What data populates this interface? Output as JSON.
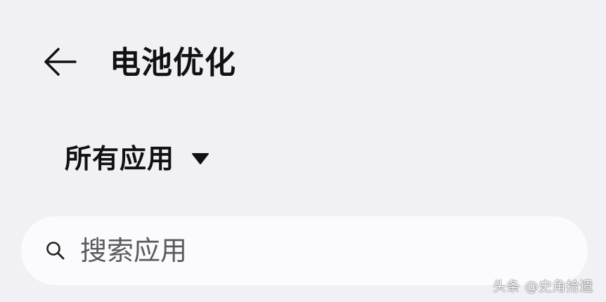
{
  "header": {
    "back_icon": "arrow-left-icon",
    "title": "电池优化"
  },
  "filter": {
    "selected_label": "所有应用",
    "caret_icon": "caret-down-icon"
  },
  "search": {
    "icon": "search-icon",
    "placeholder": "搜索应用",
    "value": ""
  },
  "watermark": {
    "text": "头条 @史角拾遗"
  },
  "colors": {
    "background": "#f1f1f5",
    "search_background": "#fbfbfd",
    "text_primary": "#111111",
    "placeholder_text": "#5a5a5e"
  }
}
